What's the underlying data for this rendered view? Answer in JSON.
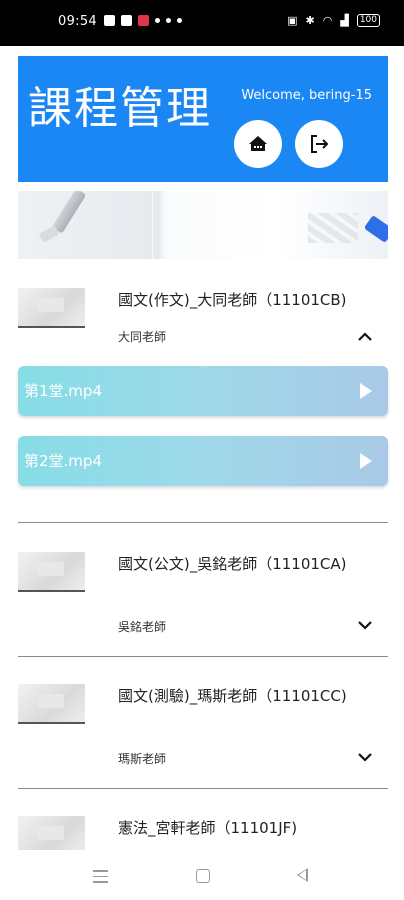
{
  "status_bar": {
    "time": "09:54",
    "battery": "100",
    "left_icons": [
      "youtube-icon",
      "photo-icon",
      "mail-icon",
      "location-icon",
      "settings-icon",
      "dot-icon"
    ],
    "right_icons": [
      "nfc-icon",
      "bluetooth-icon",
      "wifi-icon",
      "signal-icon"
    ]
  },
  "header": {
    "title": "課程管理",
    "welcome": "Welcome, bering-15",
    "home_icon": "home-icon",
    "logout_icon": "logout-icon",
    "background_color": "#1a87f5"
  },
  "courses": [
    {
      "title": "國文(作文)_大同老師（11101CB)",
      "teacher": "大同老師",
      "expanded": true,
      "videos": [
        {
          "label": "第1堂.mp4"
        },
        {
          "label": "第2堂.mp4"
        }
      ]
    },
    {
      "title": "國文(公文)_吳銘老師（11101CA)",
      "teacher": "吳銘老師",
      "expanded": false
    },
    {
      "title": "國文(測驗)_瑪斯老師（11101CC)",
      "teacher": "瑪斯老師",
      "expanded": false
    },
    {
      "title": "憲法_宮軒老師（11101JF)",
      "teacher": "",
      "expanded": false
    }
  ],
  "nav_bar": {
    "icons": [
      "menu-icon",
      "home-square-icon",
      "back-icon"
    ]
  }
}
